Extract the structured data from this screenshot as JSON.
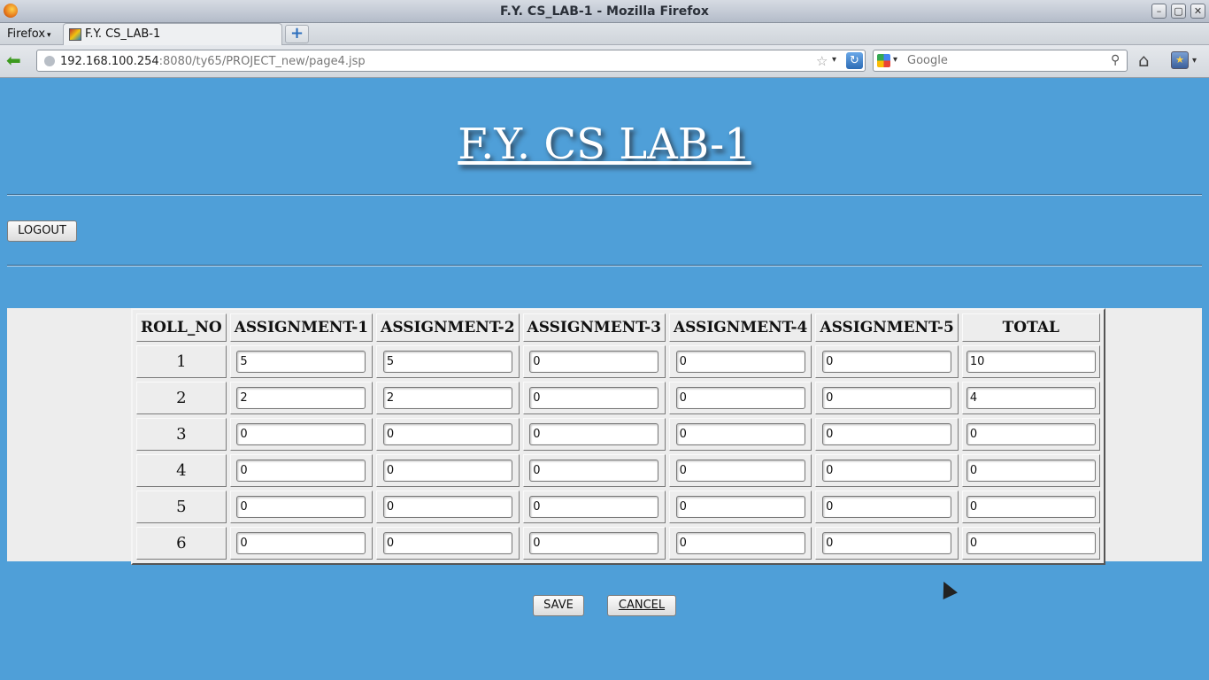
{
  "window": {
    "title": "F.Y. CS_LAB-1 - Mozilla Firefox",
    "minimize_glyph": "–",
    "maximize_glyph": "▢",
    "close_glyph": "✕"
  },
  "browser": {
    "menu_label": "Firefox",
    "menu_caret": "▾",
    "tab_title": "F.Y. CS_LAB-1",
    "new_tab_glyph": "+",
    "back_glyph": "⬅",
    "url_host": "192.168.100.254",
    "url_rest": ":8080/ty65/PROJECT_new/page4.jsp",
    "star_glyph": "☆",
    "dropdown_glyph": "▾",
    "reload_glyph": "↻",
    "search_placeholder": "Google",
    "search_glyph": "⚲",
    "home_glyph": "⌂",
    "bookmarks_glyph": "★"
  },
  "page": {
    "heading": "F.Y. CS LAB-1",
    "logout_label": "LOGOUT",
    "save_label": "SAVE",
    "cancel_label": "CANCEL"
  },
  "table": {
    "headers": [
      "ROLL_NO",
      "ASSIGNMENT-1",
      "ASSIGNMENT-2",
      "ASSIGNMENT-3",
      "ASSIGNMENT-4",
      "ASSIGNMENT-5",
      "TOTAL"
    ],
    "rows": [
      {
        "roll": "1",
        "values": [
          "5",
          "5",
          "0",
          "0",
          "0",
          "10"
        ]
      },
      {
        "roll": "2",
        "values": [
          "2",
          "2",
          "0",
          "0",
          "0",
          "4"
        ]
      },
      {
        "roll": "3",
        "values": [
          "0",
          "0",
          "0",
          "0",
          "0",
          "0"
        ]
      },
      {
        "roll": "4",
        "values": [
          "0",
          "0",
          "0",
          "0",
          "0",
          "0"
        ]
      },
      {
        "roll": "5",
        "values": [
          "0",
          "0",
          "0",
          "0",
          "0",
          "0"
        ]
      },
      {
        "roll": "6",
        "values": [
          "0",
          "0",
          "0",
          "0",
          "0",
          "0"
        ]
      }
    ]
  },
  "colors": {
    "page_background": "#4f9fd8",
    "table_panel": "#ededed"
  }
}
